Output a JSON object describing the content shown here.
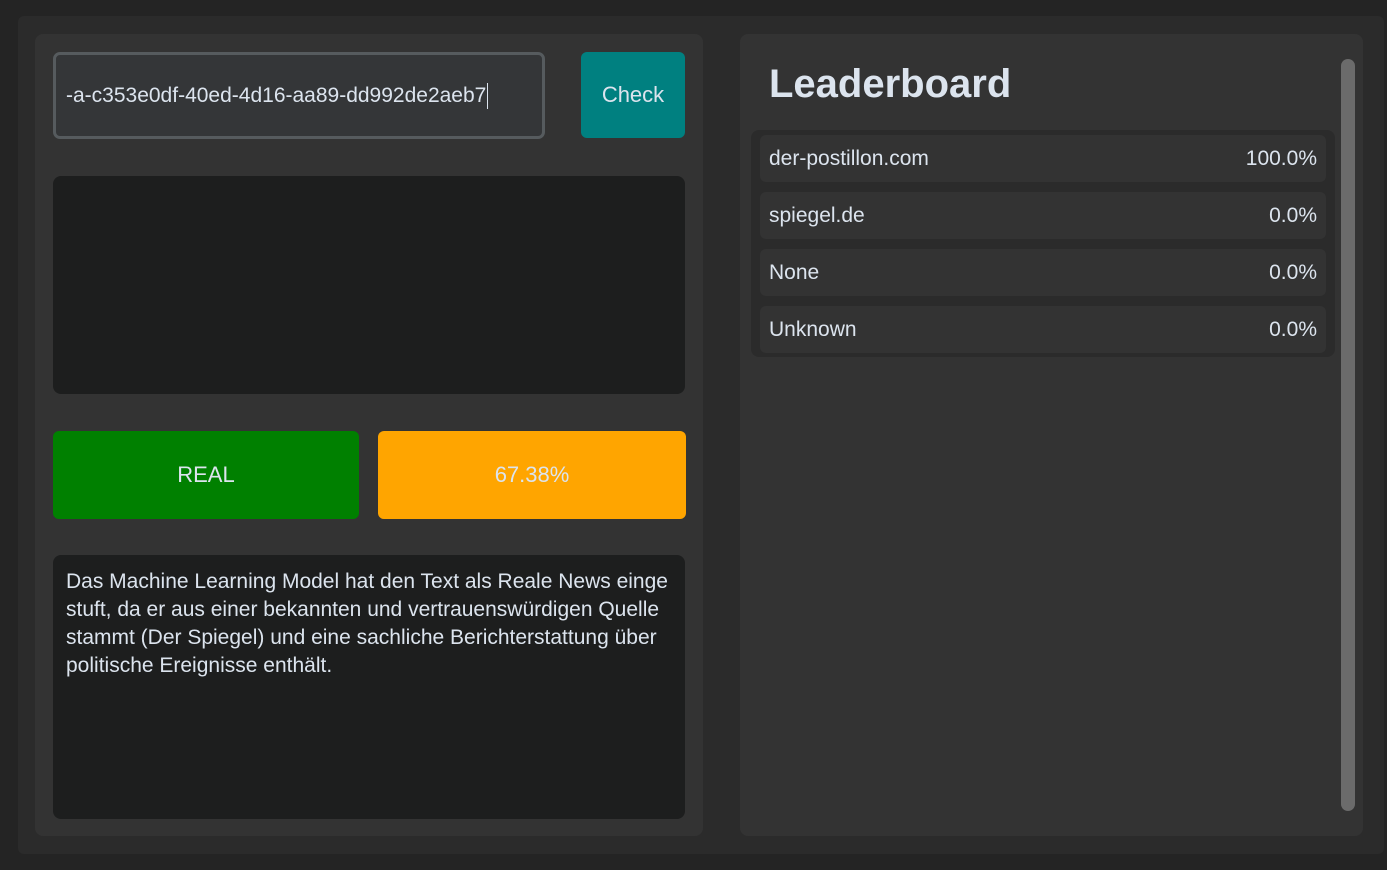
{
  "input": {
    "value": "-a-c353e0df-40ed-4d16-aa89-dd992de2aeb7"
  },
  "check_button": {
    "label": "Check"
  },
  "result": {
    "verdict": "REAL",
    "confidence": "67.38%",
    "explanation": "Das Machine Learning Model hat den Text als Reale News eingestuft, da er aus einer bekannten und vertrauenswürdigen Quelle stammt (Der Spiegel) und eine sachliche Berichterstattung über politische Ereignisse enthält."
  },
  "leaderboard": {
    "title": "Leaderboard",
    "items": [
      {
        "name": "der-postillon.com",
        "value": "100.0%"
      },
      {
        "name": "spiegel.de",
        "value": "0.0%"
      },
      {
        "name": "None",
        "value": "0.0%"
      },
      {
        "name": "Unknown",
        "value": "0.0%"
      }
    ]
  },
  "colors": {
    "check_button": "#008080",
    "verdict_real": "#008000",
    "confidence": "#ffa500",
    "background": "#242424",
    "panel": "#333333"
  }
}
